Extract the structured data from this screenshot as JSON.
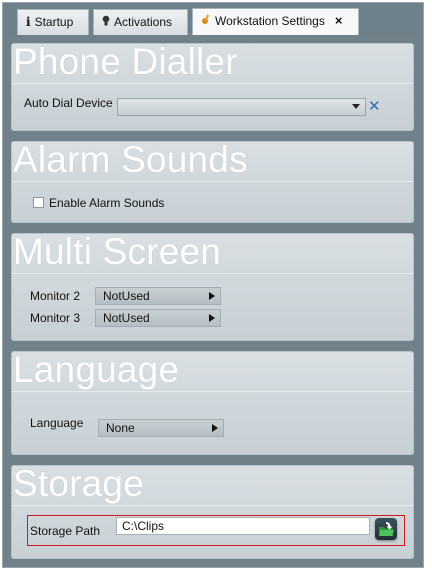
{
  "tabs": [
    {
      "label": "Startup",
      "icon": "info-icon"
    },
    {
      "label": "Activations",
      "icon": "lightbulb-icon"
    },
    {
      "label": "Workstation Settings",
      "icon": "wrench-icon",
      "close": "×"
    }
  ],
  "sections": {
    "phone_dialler": {
      "title": "Phone Dialler",
      "auto_dial_label": "Auto Dial Device",
      "auto_dial_value": "",
      "clear_glyph": "✕"
    },
    "alarm_sounds": {
      "title": "Alarm Sounds",
      "enable_label": "Enable Alarm Sounds",
      "enabled": false
    },
    "multi_screen": {
      "title": "Multi Screen",
      "monitor2_label": "Monitor 2",
      "monitor2_value": "NotUsed",
      "monitor3_label": "Monitor 3",
      "monitor3_value": "NotUsed"
    },
    "language": {
      "title": "Language",
      "language_label": "Language",
      "language_value": "None"
    },
    "storage": {
      "title": "Storage",
      "path_label": "Storage Path",
      "path_value": "C:\\Clips",
      "browse_icon": "folder-open-icon"
    }
  },
  "colors": {
    "accent_close": "#2f6fb0",
    "highlight_border": "#d21c1c",
    "panel_bg": "#d3dade",
    "window_bg": "#70818a"
  }
}
